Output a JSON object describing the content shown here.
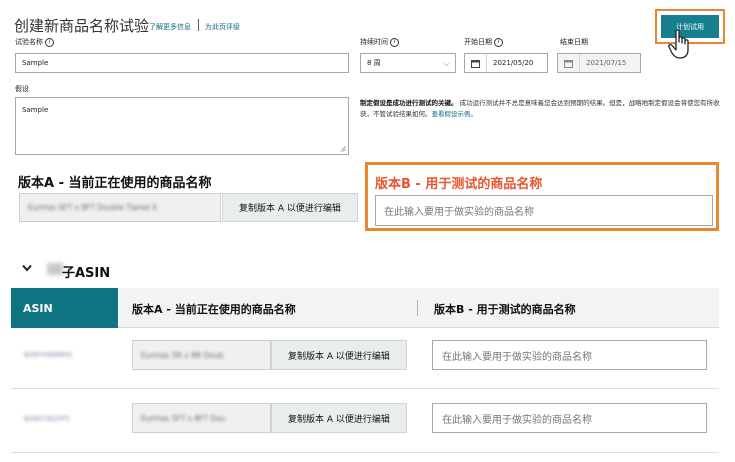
{
  "header": {
    "title": "创建新商品名称试验",
    "learn_more": "了解更多信息",
    "rate_page": "为此页评级",
    "start_button": "计划试用"
  },
  "form": {
    "experiment_name_label": "试验名称",
    "experiment_name_value": "Sample",
    "duration_label": "持续时间",
    "duration_value": "8 周",
    "start_date_label": "开始日期",
    "start_date_value": "2021/05/20",
    "end_date_label": "结束日期",
    "end_date_value": "2021/07/15",
    "hypothesis_label": "假设",
    "hypothesis_value": "Sample",
    "hypothesis_desc_bold": "制定假设是成功进行测试的关键。",
    "hypothesis_desc": "成功运行测试并不总是意味着您会达到预期的结果。但是，战略地制定假设会将使您有所收获，不管试验结果如何。",
    "hypothesis_link": "查看假设示例。"
  },
  "version_a": {
    "title": "版本A - 当前正在使用的商品名称",
    "current_value": "Eurmas SFT x 8FT Double Tiered X",
    "copy_button": "复制版本 A 以便进行编辑"
  },
  "version_b": {
    "title": "版本B - 用于测试的商品名称",
    "placeholder": "在此输入要用于做实验的商品名称"
  },
  "child_asin": {
    "title": "子ASIN",
    "columns": {
      "asin": "ASIN",
      "version_a": "版本A - 当前正在使用的商品名称",
      "version_b": "版本B - 用于测试的商品名称"
    },
    "rows": [
      {
        "asin": "B08YHN9MHC",
        "current_value": "Eurmas 5ft x 8ft Doub",
        "copy_button": "复制版本 A 以便进行编辑",
        "placeholder": "在此输入要用于做实验的商品名称"
      },
      {
        "asin": "B08G7B1PP3",
        "current_value": "Eurmas 5FT x 8FT Dou",
        "copy_button": "复制版本 A 以便进行编辑",
        "placeholder": "在此输入要用于做实验的商品名称"
      }
    ]
  },
  "colors": {
    "teal": "#16808e",
    "orange_highlight": "#e8872f",
    "version_b_title": "#e8552f",
    "link": "#0a6a83"
  },
  "icons": [
    "info-icon",
    "chevron-down-icon",
    "calendar-icon",
    "hand-cursor-icon"
  ]
}
